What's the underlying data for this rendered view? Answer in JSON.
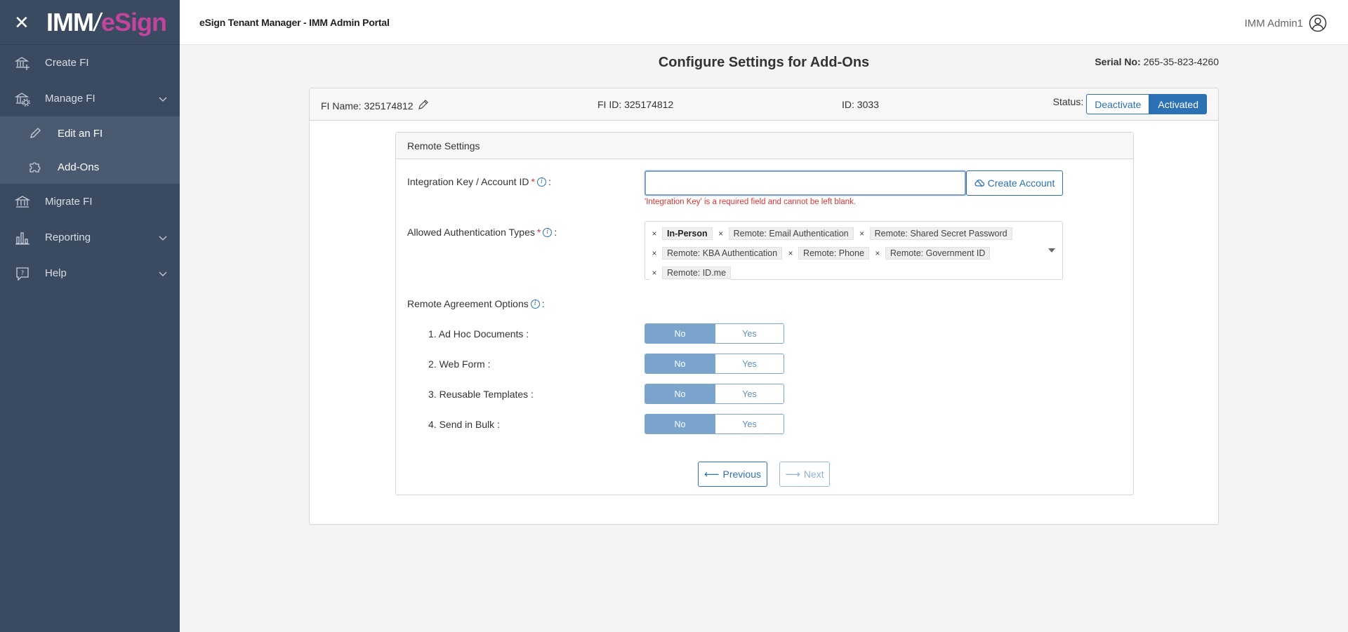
{
  "sidebar": {
    "logo_part1": "IMM",
    "logo_part2": "eSign",
    "items": [
      {
        "label": "Create FI",
        "icon": "bank-plus-icon"
      },
      {
        "label": "Manage FI",
        "icon": "bank-gear-icon"
      },
      {
        "label": "Migrate FI",
        "icon": "bank-arrow-icon"
      },
      {
        "label": "Reporting",
        "icon": "bar-chart-icon"
      },
      {
        "label": "Help",
        "icon": "help-bubble-icon"
      }
    ],
    "subitems": [
      {
        "label": "Edit an FI",
        "icon": "pencil-icon"
      },
      {
        "label": "Add-Ons",
        "icon": "puzzle-icon"
      }
    ]
  },
  "topbar": {
    "title": "eSign Tenant Manager - IMM Admin Portal",
    "user_name": "IMM Admin1"
  },
  "page": {
    "title": "Configure Settings for Add-Ons",
    "serial_label": "Serial No:",
    "serial_value": "265-35-823-4260"
  },
  "fi": {
    "name_text": "FI Name: 325174812",
    "id_text": "FI ID: 325174812",
    "internal_id_text": "ID: 3033",
    "status_label": "Status:",
    "deactivate_label": "Deactivate",
    "activated_label": "Activated"
  },
  "remote": {
    "section_title": "Remote Settings",
    "integration_key_label": "Integration Key / Account ID",
    "integration_key_value": "",
    "create_account_label": "Create Account",
    "error_text": "'Integration Key' is a required field and cannot be left blank.",
    "auth_label": "Allowed Authentication Types",
    "auth_tags": [
      "In-Person",
      "Remote: Email Authentication",
      "Remote: Shared Secret Password",
      "Remote: KBA Authentication",
      "Remote: Phone",
      "Remote: Government ID",
      "Remote: ID.me"
    ],
    "agreement_label": "Remote Agreement Options",
    "options": [
      {
        "label": "1. Ad Hoc Documents :",
        "no": "No",
        "yes": "Yes",
        "selected": "No"
      },
      {
        "label": "2. Web Form :",
        "no": "No",
        "yes": "Yes",
        "selected": "No"
      },
      {
        "label": "3. Reusable Templates :",
        "no": "No",
        "yes": "Yes",
        "selected": "No"
      },
      {
        "label": "4. Send in Bulk :",
        "no": "No",
        "yes": "Yes",
        "selected": "No"
      }
    ],
    "previous_label": "Previous",
    "next_label": "Next"
  },
  "colors": {
    "sidebar_bg": "#3a4a60",
    "accent": "#2c71b4",
    "brand_pink": "#c2449c",
    "error": "#dd3333"
  }
}
